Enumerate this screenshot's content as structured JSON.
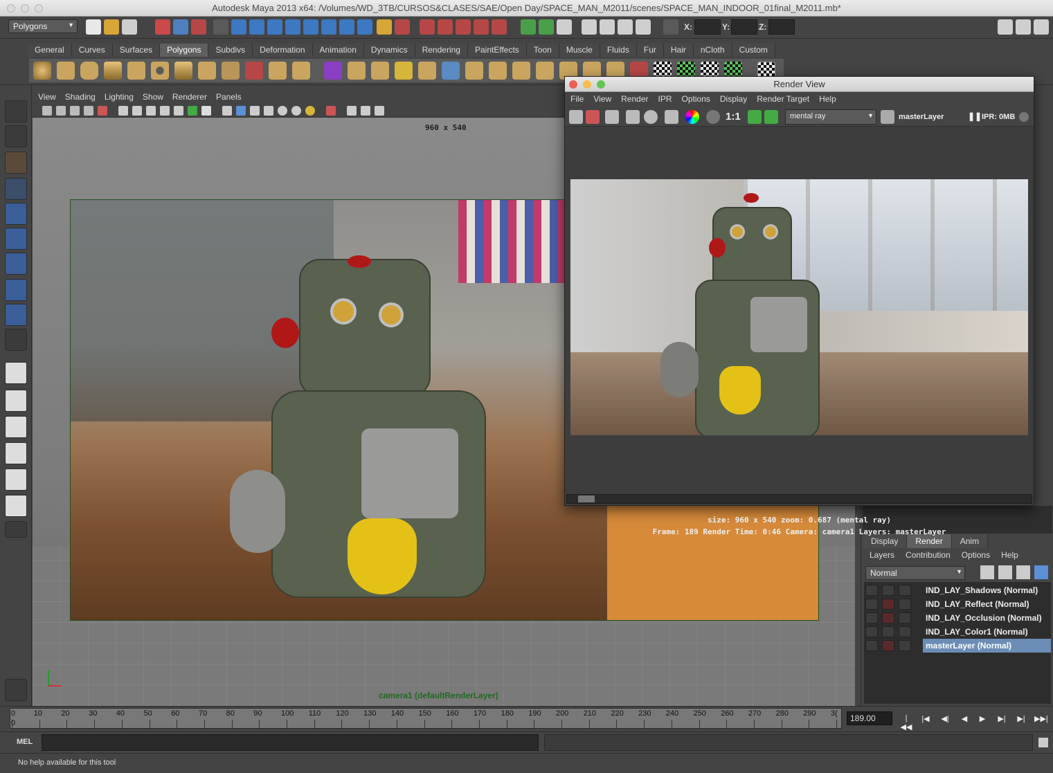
{
  "window": {
    "title": "Autodesk Maya 2013 x64: /Volumes/WD_3TB/CURSOS&CLASES/SAE/Open Day/SPACE_MAN_M2011/scenes/SPACE_MAN_INDOOR_01final_M2011.mb*"
  },
  "status_line": {
    "menu_set": "Polygons",
    "x_label": "X:",
    "y_label": "Y:",
    "z_label": "Z:",
    "x_value": "",
    "y_value": "",
    "z_value": ""
  },
  "shelf": {
    "tabs": [
      "General",
      "Curves",
      "Surfaces",
      "Polygons",
      "Subdivs",
      "Deformation",
      "Animation",
      "Dynamics",
      "Rendering",
      "PaintEffects",
      "Toon",
      "Muscle",
      "Fluids",
      "Fur",
      "Hair",
      "nCloth",
      "Custom"
    ],
    "active_tab": "Polygons"
  },
  "viewport": {
    "menus": [
      "View",
      "Shading",
      "Lighting",
      "Show",
      "Renderer",
      "Panels"
    ],
    "resolution_label": "960 x 540",
    "camera_label": "camera1 (defaultRenderLayer)"
  },
  "render_view": {
    "title": "Render View",
    "menus": [
      "File",
      "View",
      "Render",
      "IPR",
      "Options",
      "Display",
      "Render Target",
      "Help"
    ],
    "ratio_label": "1:1",
    "renderer": "mental ray",
    "layer": "masterLayer",
    "ipr": "IPR: 0MB",
    "info_line1": "size: 960 x 540 zoom: 0.687      (mental ray)",
    "info_line2": "Frame: 189      Render Time: 0:46      Camera: camera1      Layers: masterLayer"
  },
  "layer_editor": {
    "tabs": [
      "Display",
      "Render",
      "Anim"
    ],
    "active_tab": "Render",
    "menus": [
      "Layers",
      "Contribution",
      "Options",
      "Help"
    ],
    "blend_mode": "Normal",
    "layers": [
      {
        "name": "IND_LAY_Shadows (Normal)",
        "selected": false
      },
      {
        "name": "IND_LAY_Reflect (Normal)",
        "selected": false
      },
      {
        "name": "IND_LAY_Occlusion (Normal)",
        "selected": false
      },
      {
        "name": "IND_LAY_Color1 (Normal)",
        "selected": false
      },
      {
        "name": "masterLayer (Normal)",
        "selected": true
      }
    ]
  },
  "time_slider": {
    "ticks": [
      "0",
      "10",
      "20",
      "30",
      "40",
      "50",
      "60",
      "70",
      "80",
      "90",
      "100",
      "110",
      "120",
      "130",
      "140",
      "150",
      "160",
      "170",
      "180",
      "190",
      "200",
      "210",
      "220",
      "230",
      "240",
      "250",
      "260",
      "270",
      "280",
      "290",
      "3("
    ],
    "current_frame": "189.00",
    "start_marker": "0"
  },
  "command_line": {
    "label": "MEL"
  },
  "help_line": {
    "text": "No help available for this tool"
  },
  "colors": {
    "accent_selected": "#6b8db5",
    "camera_label": "#1d6a1d",
    "ui_bg": "#444444"
  }
}
